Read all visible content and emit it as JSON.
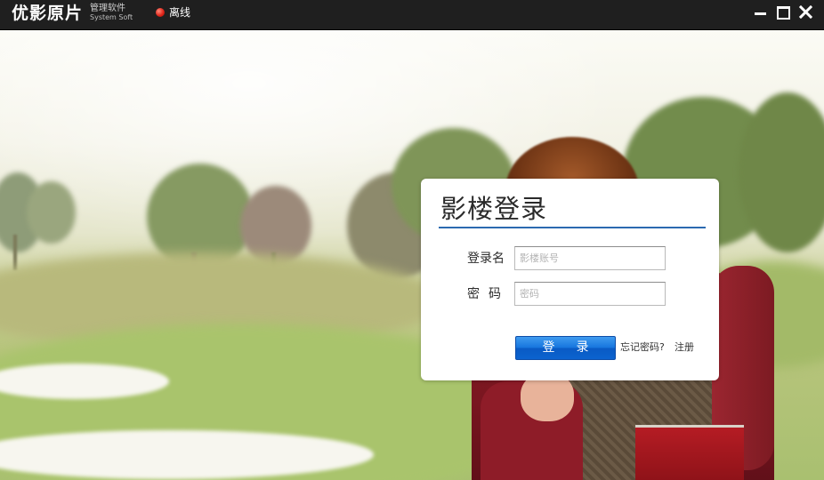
{
  "titlebar": {
    "logo_main": "优影原片",
    "logo_sub1": "管理软件",
    "logo_sub2": "System Soft",
    "status_text": "离线",
    "status_color": "#e0261a",
    "buttons": [
      "minimize-icon",
      "maximize-icon",
      "close-icon"
    ]
  },
  "login": {
    "title": "影楼登录",
    "username_label": "登录名",
    "username_placeholder": "影楼账号",
    "password_label": "密码",
    "password_placeholder": "密码",
    "submit_label": "登录",
    "forgot_link": "忘记密码?",
    "register_link": "注册",
    "accent_color": "#1574dd"
  }
}
